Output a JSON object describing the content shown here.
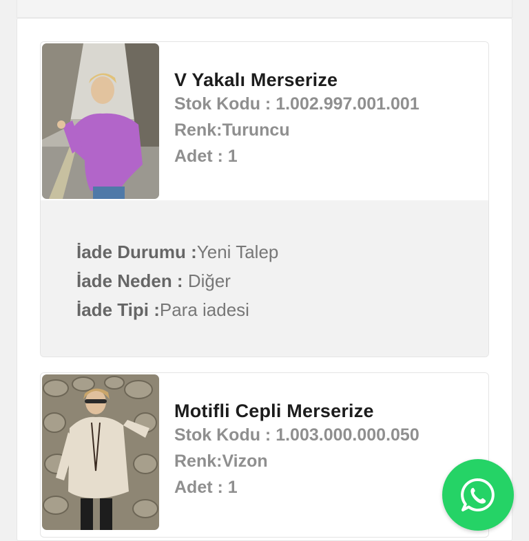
{
  "orders": [
    {
      "title": "V Yakalı Merserize",
      "stock_code": "Stok Kodu : 1.002.997.001.001",
      "color": "Renk:Turuncu",
      "quantity": "Adet : 1",
      "image_icon": "product-photo-purple-sweater",
      "return": {
        "status_label": "İade Durumu :",
        "status_value": "Yeni Talep",
        "reason_label": "İade Neden : ",
        "reason_value": "Diğer",
        "type_label": "İade Tipi :",
        "type_value": "Para iadesi"
      }
    },
    {
      "title": "Motifli Cepli Merserize",
      "stock_code": "Stok Kodu : 1.003.000.000.050",
      "color": "Renk:Vizon",
      "quantity": "Adet : 1",
      "image_icon": "product-photo-beige-tunic"
    }
  ],
  "whatsapp": {
    "icon": "whatsapp-icon",
    "color": "#25d366"
  },
  "colors": {
    "title": "#1c1c1c",
    "meta": "#8f8f8f",
    "return_bg": "#f2f2f2"
  }
}
